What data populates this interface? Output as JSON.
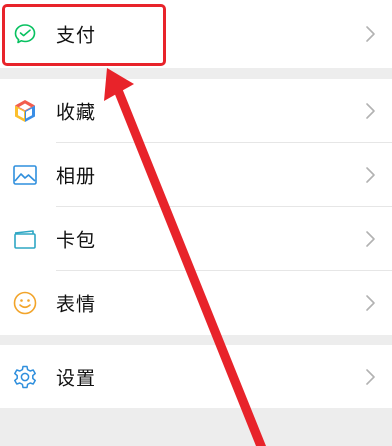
{
  "menu": {
    "pay": {
      "label": "支付",
      "icon": "wechat-pay-icon"
    },
    "items": [
      {
        "label": "收藏",
        "icon": "favorites-cube-icon"
      },
      {
        "label": "相册",
        "icon": "album-image-icon"
      },
      {
        "label": "卡包",
        "icon": "card-wallet-icon"
      },
      {
        "label": "表情",
        "icon": "smile-emoji-icon"
      }
    ],
    "settings": {
      "label": "设置",
      "icon": "gear-icon"
    }
  },
  "colors": {
    "background": "#ededed",
    "pay_green": "#07c160",
    "annotation_red": "#e8232a"
  }
}
